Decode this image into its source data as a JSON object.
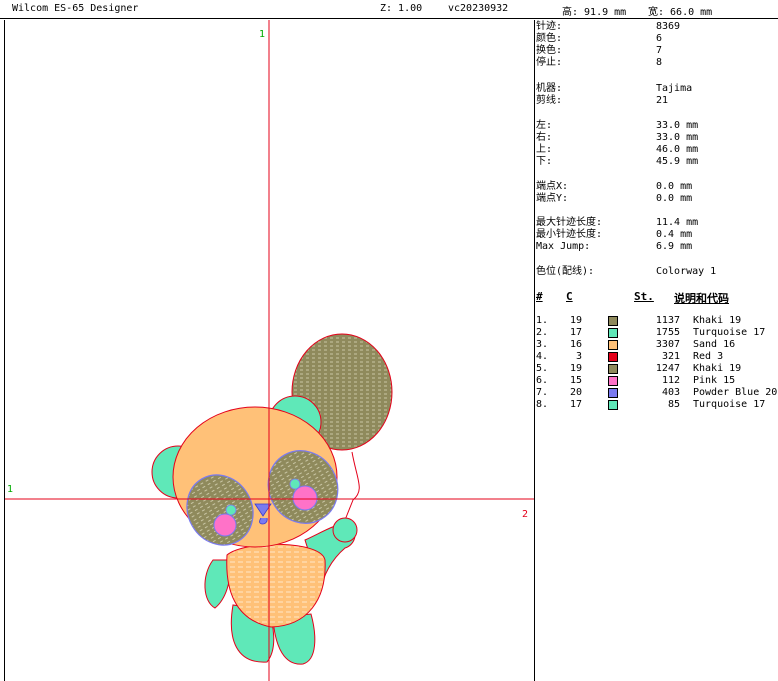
{
  "app": {
    "title": "Wilcom ES-65 Designer",
    "zoom": "Z: 1.00",
    "version": "vc20230932",
    "height": "高: 91.9 mm",
    "width": "宽: 66.0 mm"
  },
  "canvas": {
    "axis_top_label": "1",
    "axis_left_label": "1",
    "axis_right_label": "2"
  },
  "stats": [
    {
      "label": "针迹:",
      "value": "8369"
    },
    {
      "label": "颜色:",
      "value": "6"
    },
    {
      "label": "换色:",
      "value": "7"
    },
    {
      "label": "停止:",
      "value": "8"
    },
    {
      "label": "机器:",
      "value": "Tajima"
    },
    {
      "label": "剪线:",
      "value": "21"
    },
    {
      "label": "左:",
      "value": "33.0 mm"
    },
    {
      "label": "右:",
      "value": "33.0 mm"
    },
    {
      "label": "上:",
      "value": "46.0 mm"
    },
    {
      "label": "下:",
      "value": "45.9 mm"
    },
    {
      "label": "端点X:",
      "value": "0.0 mm"
    },
    {
      "label": "端点Y:",
      "value": "0.0 mm"
    },
    {
      "label": "最大针迹长度:",
      "value": "11.4 mm"
    },
    {
      "label": "最小针迹长度:",
      "value": "0.4 mm"
    },
    {
      "label": "Max Jump:",
      "value": "6.9 mm"
    },
    {
      "label": "色位(配线):",
      "value": "Colorway 1"
    }
  ],
  "table": {
    "headers": {
      "idx": "#",
      "code": "C",
      "st": "St.",
      "desc": "说明和代码"
    },
    "rows": [
      {
        "idx": "1.",
        "code": "19",
        "color": "#8f8a5c",
        "st": "1137",
        "desc": "Khaki 19"
      },
      {
        "idx": "2.",
        "code": "17",
        "color": "#5fe8b8",
        "st": "1755",
        "desc": "Turquoise 17"
      },
      {
        "idx": "3.",
        "code": "16",
        "color": "#ffc178",
        "st": "3307",
        "desc": "Sand 16"
      },
      {
        "idx": "4.",
        "code": "3",
        "color": "#e4001a",
        "st": "321",
        "desc": "Red 3"
      },
      {
        "idx": "5.",
        "code": "19",
        "color": "#8f8a5c",
        "st": "1247",
        "desc": "Khaki 19"
      },
      {
        "idx": "6.",
        "code": "15",
        "color": "#ff72c8",
        "st": "112",
        "desc": "Pink 15"
      },
      {
        "idx": "7.",
        "code": "20",
        "color": "#7a7af0",
        "st": "403",
        "desc": "Powder Blue 20"
      },
      {
        "idx": "8.",
        "code": "17",
        "color": "#5fe8b8",
        "st": "85",
        "desc": "Turquoise 17"
      }
    ]
  }
}
